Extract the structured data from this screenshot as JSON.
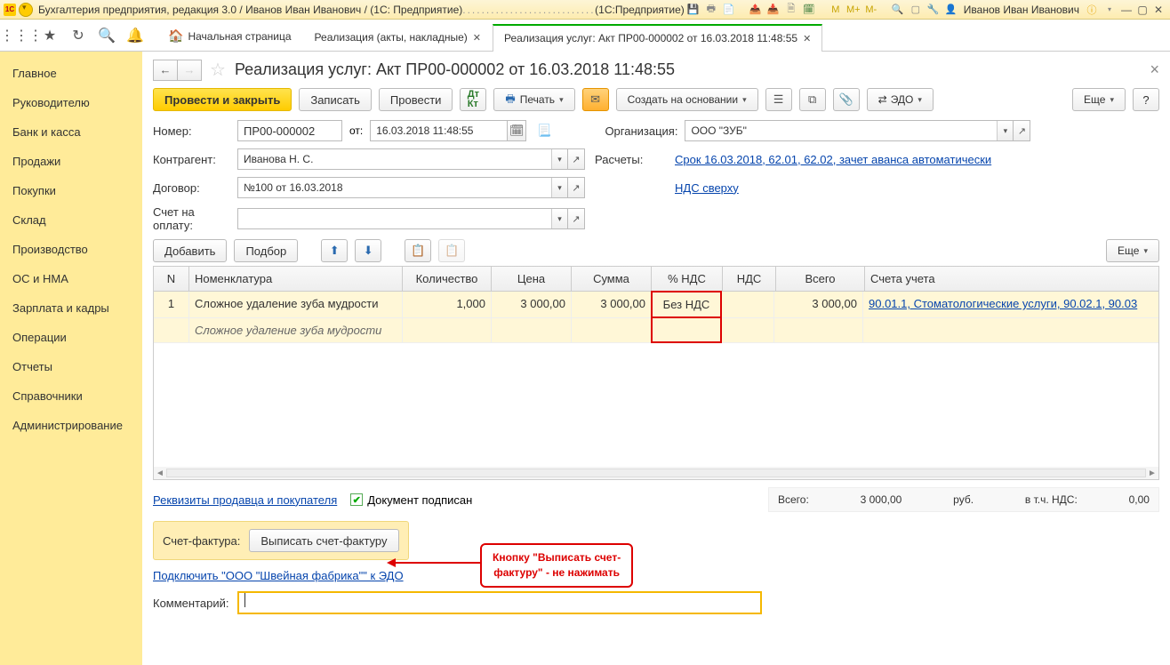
{
  "titlebar": {
    "app_title": "Бухгалтерия предприятия, редакция 3.0 / Иванов Иван Иванович / (1С: Предприятие)",
    "product": "(1С:Предприятие)",
    "user": "Иванов Иван Иванович"
  },
  "tabs": {
    "home": "Начальная страница",
    "t1": "Реализация (акты, накладные)",
    "t2": "Реализация услуг: Акт ПР00-000002 от 16.03.2018 11:48:55"
  },
  "leftnav": [
    "Главное",
    "Руководителю",
    "Банк и касса",
    "Продажи",
    "Покупки",
    "Склад",
    "Производство",
    "ОС и НМА",
    "Зарплата и кадры",
    "Операции",
    "Отчеты",
    "Справочники",
    "Администрирование"
  ],
  "page": {
    "title": "Реализация услуг: Акт ПР00-000002 от 16.03.2018 11:48:55"
  },
  "toolbar": {
    "post_close": "Провести и закрыть",
    "write": "Записать",
    "post": "Провести",
    "print": "Печать",
    "create_based": "Создать на основании",
    "edo": "ЭДО",
    "more": "Еще",
    "help": "?"
  },
  "form": {
    "number_lbl": "Номер:",
    "number_val": "ПР00-000002",
    "from_lbl": "от:",
    "date_val": "16.03.2018 11:48:55",
    "org_lbl": "Организация:",
    "org_val": "ООО \"ЗУБ\"",
    "contr_lbl": "Контрагент:",
    "contr_val": "Иванова Н. С.",
    "contract_lbl": "Договор:",
    "contract_val": "№100 от 16.03.2018",
    "calc_lbl": "Расчеты:",
    "calc_link": "Срок 16.03.2018, 62.01, 62.02, зачет аванса автоматически",
    "vat_link": "НДС сверху",
    "invoice_acc_lbl": "Счет на оплату:"
  },
  "tbl_toolbar": {
    "add": "Добавить",
    "pick": "Подбор",
    "up": "↑",
    "down": "↓",
    "more": "Еще"
  },
  "table": {
    "cols": {
      "n": "N",
      "nom": "Номенклатура",
      "qty": "Количество",
      "price": "Цена",
      "sum": "Сумма",
      "vatp": "% НДС",
      "vat": "НДС",
      "total": "Всего",
      "acc": "Счета учета"
    },
    "row": {
      "n": "1",
      "nom": "Сложное удаление зуба мудрости",
      "nom_sub": "Сложное удаление зуба мудрости",
      "qty": "1,000",
      "price": "3 000,00",
      "sum": "3 000,00",
      "vatp": "Без НДС",
      "vat": "",
      "total": "3 000,00",
      "acc": "90.01.1, Стоматологические услуги, 90.02.1, 90.03"
    }
  },
  "totals": {
    "link": "Реквизиты продавца и покупателя",
    "signed": "Документ подписан",
    "total_lbl": "Всего:",
    "total_val": "3 000,00",
    "currency": "руб.",
    "vat_inc_lbl": "в т.ч. НДС:",
    "vat_inc_val": "0,00"
  },
  "invoice": {
    "lbl": "Счет-фактура:",
    "btn": "Выписать счет-фактуру"
  },
  "edo_link": "Подключить \"ООО \"Швейная фабрика\"\" к ЭДО",
  "callout": {
    "l1": "Кнопку \"Выписать счет-",
    "l2": "фактуру\" - не нажимать"
  },
  "comment_lbl": "Комментарий:"
}
